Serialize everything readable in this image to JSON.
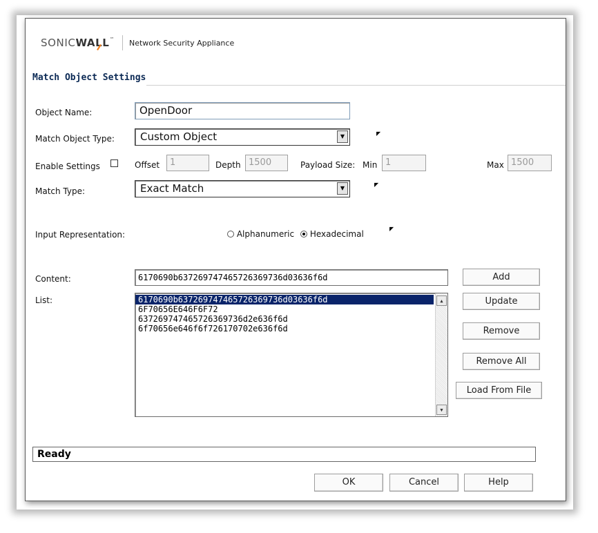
{
  "header": {
    "brand_prefix": "SONIC",
    "brand_suffix": "WALL",
    "brand_tm": "™",
    "product": "Network Security Appliance"
  },
  "section_title": "Match Object Settings",
  "form": {
    "object_name_label": "Object Name:",
    "object_name_value": "OpenDoor",
    "match_object_type_label": "Match Object Type:",
    "match_object_type_value": "Custom Object",
    "enable_settings_label": "Enable Settings",
    "enable_settings_checked": false,
    "offset_label": "Offset",
    "offset_value": "1",
    "depth_label": "Depth",
    "depth_value": "1500",
    "payload_size_label": "Payload Size:",
    "min_label": "Min",
    "min_value": "1",
    "max_label": "Max",
    "max_value": "1500",
    "match_type_label": "Match Type:",
    "match_type_value": "Exact Match",
    "input_representation_label": "Input Representation:",
    "radio_alphanumeric": "Alphanumeric",
    "radio_hexadecimal": "Hexadecimal",
    "selected_representation": "Hexadecimal",
    "content_label": "Content:",
    "content_value": "6170690b637269747465726369736d03636f6d",
    "list_label": "List:"
  },
  "list_items": [
    "6170690b637269747465726369736d03636f6d",
    "6F70656E646F6F72",
    "637269747465726369736d2e636f6d",
    "6f70656e646f6f726170702e636f6d"
  ],
  "selected_list_index": 0,
  "side_buttons": {
    "add": "Add",
    "update": "Update",
    "remove": "Remove",
    "remove_all": "Remove All",
    "load_from_file": "Load From File"
  },
  "status_text": "Ready",
  "footer_buttons": {
    "ok": "OK",
    "cancel": "Cancel",
    "help": "Help"
  },
  "colors": {
    "selection_bg": "#0a246a",
    "title_text": "#0c2a55",
    "brand_accent": "#f58220"
  },
  "icons": {
    "dropdown": "chevron-down-icon",
    "scroll_up": "scroll-up-arrow-icon",
    "scroll_down": "scroll-down-arrow-icon",
    "brand_mark": "orange-slash-logo-icon"
  }
}
